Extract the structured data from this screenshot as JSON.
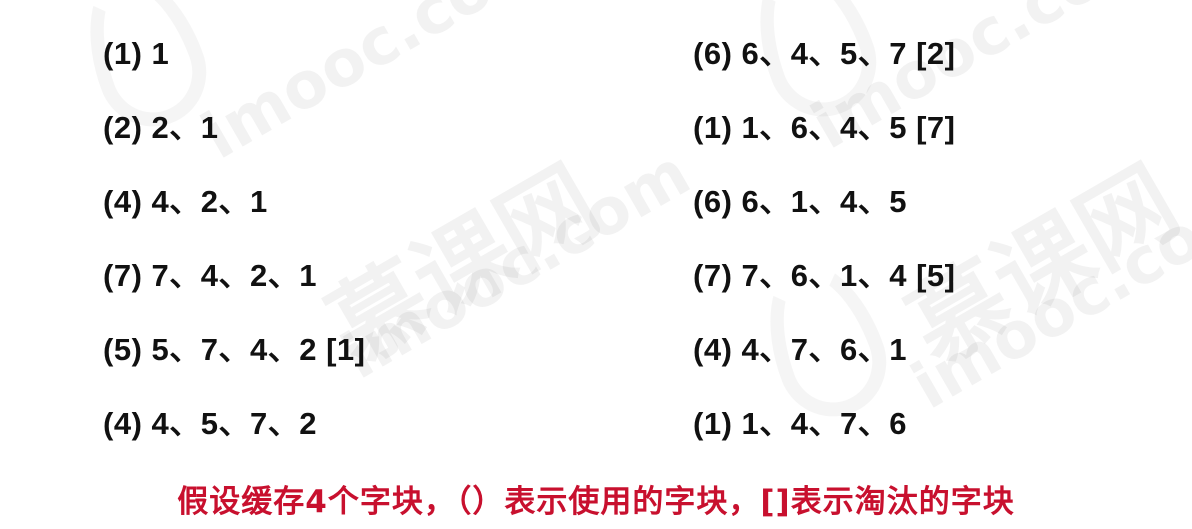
{
  "watermark": {
    "brand_cn": "慕课网",
    "brand_url": "imooc.com"
  },
  "left_column": [
    "(1) 1",
    "(2) 2、1",
    "(4) 4、2、1",
    "(7) 7、4、2、1",
    "(5) 5、7、4、2 [1]",
    "(4) 4、5、7、2"
  ],
  "right_column": [
    "(6) 6、4、5、7 [2]",
    "(1) 1、6、4、5 [7]",
    "(6) 6、1、4、5",
    "(7) 7、6、1、4 [5]",
    "(4) 4、7、6、1",
    "(1) 1、4、7、6"
  ],
  "caption": "假设缓存4个字块，（）表示使用的字块，[]表示淘汰的字块",
  "colors": {
    "caption": "#c8102e",
    "text": "#111111"
  }
}
